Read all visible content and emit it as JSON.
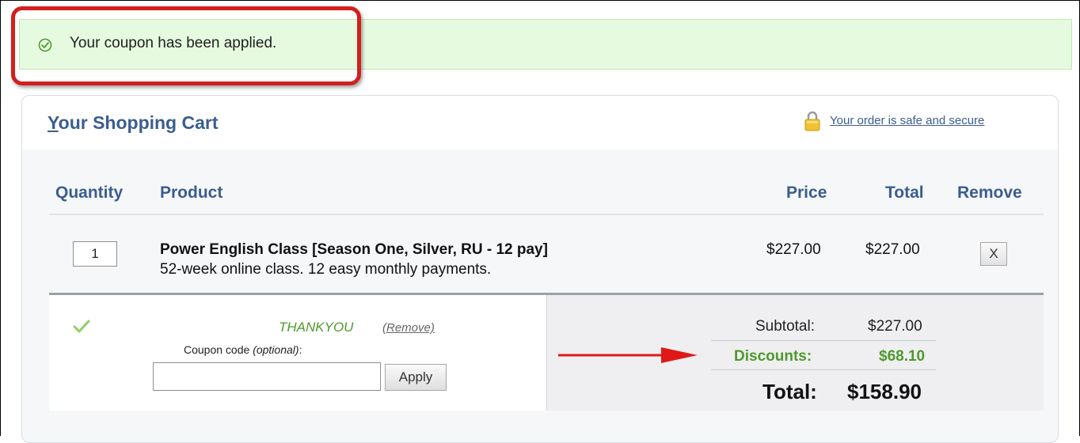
{
  "notice": {
    "message": "Your coupon has been applied."
  },
  "cart": {
    "title_first": "Y",
    "title_rest": "our Shopping Cart",
    "secure_link": "Your order is safe and secure",
    "columns": {
      "quantity": "Quantity",
      "product": "Product",
      "price": "Price",
      "total": "Total",
      "remove": "Remove"
    },
    "items": [
      {
        "quantity": "1",
        "name": "Power English Class [Season One, Silver, RU - 12 pay]",
        "description": "52-week online class. 12 easy monthly payments.",
        "price": "$227.00",
        "total": "$227.00",
        "remove_label": "X"
      }
    ]
  },
  "coupon": {
    "applied_code": "THANKYOU",
    "remove_label": "(Remove)",
    "label_main": "Coupon code ",
    "label_optional": "(optional)",
    "label_colon": ":",
    "input_value": "",
    "apply_label": "Apply"
  },
  "summary": {
    "subtotal_label": "Subtotal:",
    "subtotal_value": "$227.00",
    "discount_label": "Discounts:",
    "discount_value": "$68.10",
    "total_label": "Total:",
    "total_value": "$158.90"
  },
  "colors": {
    "accent": "#3b5d8f",
    "success_bg": "#e6fae0",
    "discount_green": "#4e9a2b",
    "annotation_red": "#d21f1f"
  },
  "icons": {
    "notice": "check-circle-icon",
    "secure": "lock-icon",
    "coupon_status": "checkmark-icon",
    "annotation": "arrow-right-icon"
  }
}
